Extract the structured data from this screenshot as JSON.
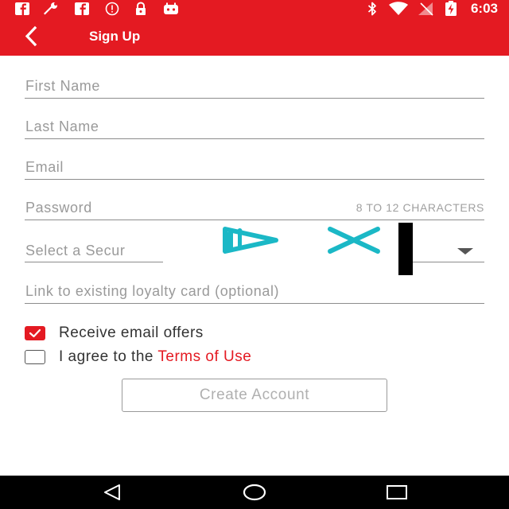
{
  "status_bar": {
    "time": "6:03",
    "left_icons": [
      "facebook-icon",
      "wrench-icon",
      "facebook-icon",
      "alert-icon",
      "lock-icon",
      "android-icon"
    ],
    "right_icons": [
      "bluetooth-icon",
      "wifi-icon",
      "signal-icon",
      "battery-icon"
    ],
    "color": "#e41a22"
  },
  "app_bar": {
    "title": "Sign Up",
    "back_icon": "back-arrow-icon"
  },
  "form": {
    "first_name": {
      "placeholder": "First Name",
      "value": ""
    },
    "last_name": {
      "placeholder": "Last Name",
      "value": ""
    },
    "email": {
      "placeholder": "Email",
      "value": ""
    },
    "password": {
      "placeholder": "Password",
      "value": "",
      "hint": "8 TO 12 CHARACTERS"
    },
    "security_question": {
      "visible_text": "Select a Secur",
      "dropdown_icon": "dropdown-arrow-icon"
    },
    "loyalty_card": {
      "placeholder": "Link to existing loyalty card (optional)",
      "value": ""
    }
  },
  "checkboxes": {
    "email_offers": {
      "label": "Receive email offers",
      "checked": true
    },
    "terms": {
      "label_prefix": "I agree to the ",
      "link_text": "Terms of Use",
      "checked": false
    }
  },
  "create_button": {
    "label": "Create Account"
  },
  "ad_overlay": {
    "icons": [
      "ad-choices-icon",
      "close-icon"
    ]
  },
  "nav_bar": {
    "icons": [
      "nav-back-icon",
      "nav-home-icon",
      "nav-recents-icon"
    ]
  }
}
